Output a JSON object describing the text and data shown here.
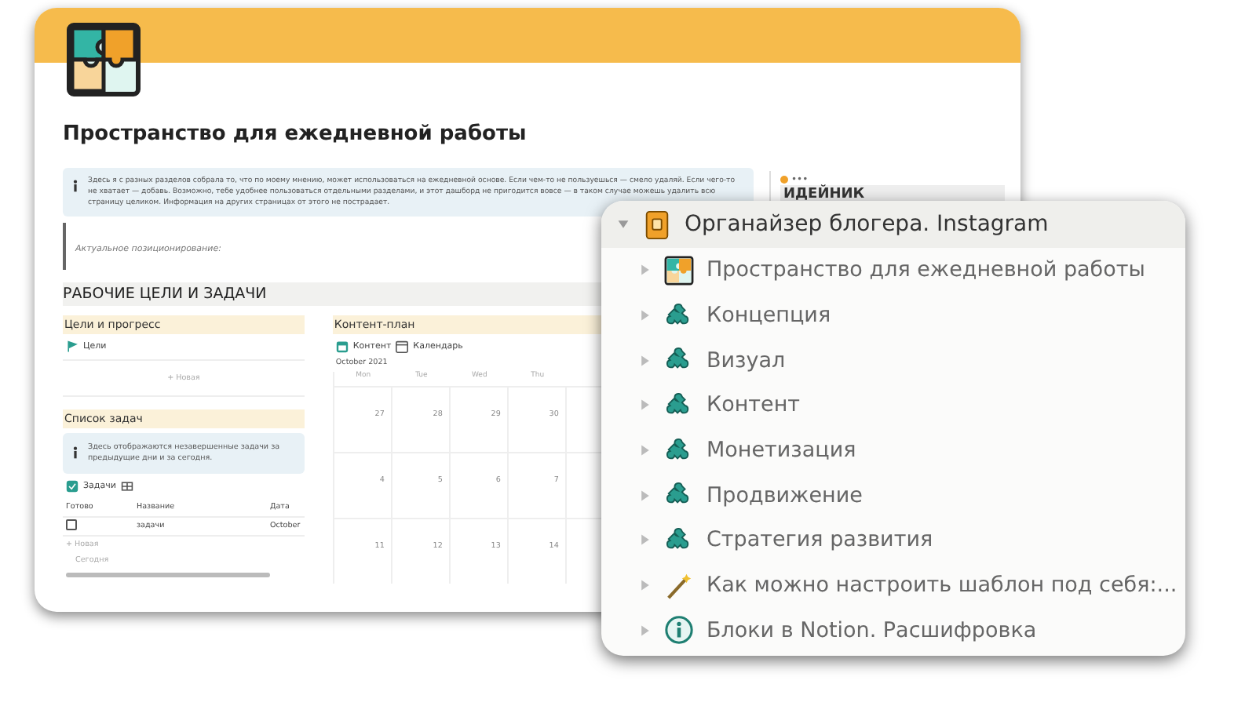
{
  "page": {
    "title": "Пространство для ежедневной работы",
    "callout": "Здесь я с разных разделов собрала то, что по моему мнению, может использоваться на ежедневной основе. Если чем-то не пользуешься — смело удаляй. Если чего-то не хватает — добавь. Возможно, тебе удобнее пользоваться отдельными разделами, и этот дашборд не пригодится вовсе — в таком случае можешь удалить всю страницу целиком. Информация на других страницах от этого не пострадает.",
    "quote": "Актуальное позиционирование:",
    "section_heading": "РАБОЧИЕ ЦЕЛИ И ЗАДАЧИ",
    "goals": {
      "heading": "Цели и прогресс",
      "view": "Цели",
      "new": "+ Новая"
    },
    "tasks": {
      "heading": "Список задач",
      "callout": "Здесь отображаются незавершенные задачи за предыдущие дни и за сегодня.",
      "view": "Задачи",
      "columns": [
        "Готово",
        "Название",
        "Дата"
      ],
      "rows": [
        {
          "checked": false,
          "name": "задачи",
          "date": "October"
        }
      ],
      "new": "+ Новая",
      "filter": "Сегодня"
    },
    "content_plan": {
      "heading": "Контент-план",
      "view": "Контент",
      "layout": "Календарь",
      "month": "October 2021",
      "weekdays": [
        "Mon",
        "Tue",
        "Wed",
        "Thu"
      ],
      "weeks": [
        [
          "27",
          "28",
          "29",
          "30"
        ],
        [
          "4",
          "5",
          "6",
          "7"
        ],
        [
          "11",
          "12",
          "13",
          "14"
        ]
      ]
    },
    "sidebar": {
      "dots": "•••",
      "heading": "ИДЕЙНИК"
    }
  },
  "tree": {
    "title": "Органайзер блогера. Instagram",
    "kind": "notebook",
    "expanded": true,
    "children": [
      {
        "title": "Пространство для ежедневной работы",
        "kind": "puzzle-color",
        "expanded": false
      },
      {
        "title": "Концепция",
        "kind": "puzzle",
        "expanded": false
      },
      {
        "title": "Визуал",
        "kind": "puzzle",
        "expanded": false
      },
      {
        "title": "Контент",
        "kind": "puzzle",
        "expanded": false
      },
      {
        "title": "Монетизация",
        "kind": "puzzle",
        "expanded": false
      },
      {
        "title": "Продвижение",
        "kind": "puzzle",
        "expanded": false
      },
      {
        "title": "Стратегия развития",
        "kind": "puzzle",
        "expanded": false
      },
      {
        "title": "Как можно настроить шаблон под себя:...",
        "kind": "wand",
        "expanded": false
      },
      {
        "title": "Блоки в Notion. Расшифровка",
        "kind": "info",
        "expanded": false
      }
    ]
  }
}
